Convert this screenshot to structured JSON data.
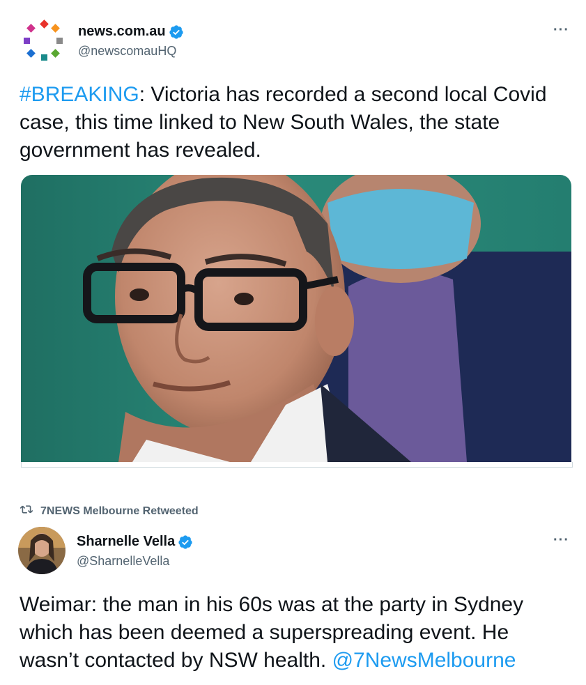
{
  "tweet1": {
    "name": "news.com.au",
    "handle": "@newscomauHQ",
    "more": "···",
    "hashtag": "#BREAKING",
    "text": ": Victoria has recorded a second local Covid case, this time linked to New South Wales, the state government has revealed."
  },
  "tweet2": {
    "retweet_label": "7NEWS Melbourne Retweeted",
    "name": "Sharnelle Vella",
    "handle": "@SharnelleVella",
    "more": "···",
    "text": "Weimar: the man in his 60s was at the party in Sydney which has been deemed a superspreading event. He wasn’t contacted by NSW health. ",
    "mention": "@7NewsMelbourne"
  },
  "colors": {
    "link": "#1d9bf0",
    "verified": "#1d9bf0",
    "secondary_text": "#536471"
  },
  "icons": [
    "verified-badge-icon",
    "more-options-icon",
    "retweet-icon"
  ]
}
